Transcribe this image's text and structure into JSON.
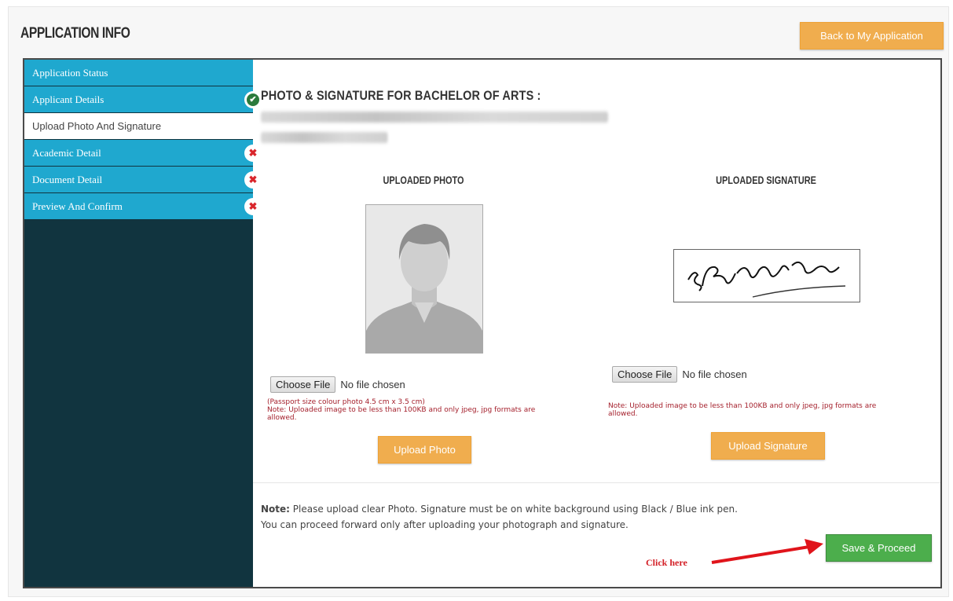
{
  "header": {
    "title": "APPLICATION INFO",
    "back_button": "Back to My Application"
  },
  "sidebar": {
    "items": [
      {
        "label": "Application Status",
        "status": ""
      },
      {
        "label": "Applicant Details",
        "status": "complete"
      },
      {
        "label": "Upload Photo And Signature",
        "status": "current"
      },
      {
        "label": "Academic Detail",
        "status": "incomplete"
      },
      {
        "label": "Document Detail",
        "status": "incomplete"
      },
      {
        "label": "Preview And Confirm",
        "status": "incomplete"
      }
    ],
    "status_icons": {
      "complete": "check-circle-icon",
      "incomplete": "close-x-icon"
    }
  },
  "main": {
    "section_title": "PHOTO & SIGNATURE FOR BACHELOR OF ARTS :",
    "photo": {
      "heading": "UPLOADED PHOTO",
      "choose_file": "Choose File",
      "file_status": "No file chosen",
      "note_line1": "(Passport size colour photo 4.5 cm x 3.5 cm)",
      "note_line2": "Note: Uploaded image to be less than 100KB and only jpeg, jpg formats are allowed.",
      "upload_button": "Upload Photo"
    },
    "signature": {
      "heading": "UPLOADED SIGNATURE",
      "choose_file": "Choose File",
      "file_status": "No file chosen",
      "note": "Note: Uploaded image to be less than 100KB and only jpeg, jpg formats are allowed.",
      "upload_button": "Upload Signature"
    },
    "footer_note": {
      "bold": "Note:",
      "line1": " Please upload clear Photo. Signature must be on white background using Black / Blue ink pen.",
      "line2": "You can proceed forward only after uploading your photograph and signature."
    },
    "save_button": "Save & Proceed",
    "annotation": "Click here"
  },
  "colors": {
    "sidebar_bg": "#11343f",
    "sidebar_item": "#1fa8cf",
    "accent_orange": "#f0ad4e",
    "accent_green": "#4cae4c",
    "error_red": "#d9262c",
    "annotation_red": "#d31f26"
  }
}
